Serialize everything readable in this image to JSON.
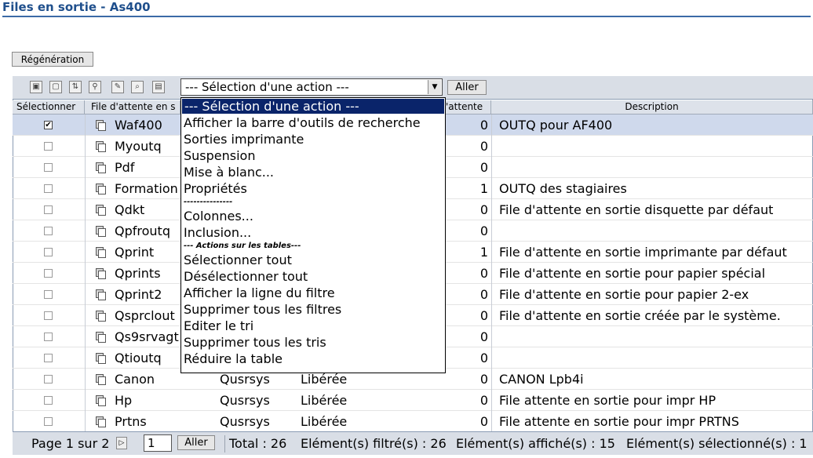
{
  "page": {
    "title": "Files en sortie - As400"
  },
  "regen_button": "Régénération",
  "toolbar": {
    "icons": [
      "select-all-icon",
      "deselect-all-icon",
      "filter-icon",
      "search-toolbar-icon",
      "edit-icon",
      "sort-icon",
      "columns-icon"
    ],
    "action_select_value": "--- Sélection d'une action ---",
    "go_label": "Aller"
  },
  "columns": {
    "select": "Sélectionner",
    "queue": "File d'attente en s",
    "queue_tail": "'attente",
    "description": "Description"
  },
  "rows": [
    {
      "name": "Waf400",
      "library": "",
      "state": "",
      "count": "0",
      "description": "OUTQ pour AF400",
      "selected": true
    },
    {
      "name": "Myoutq",
      "library": "",
      "state": "",
      "count": "0",
      "description": "",
      "selected": false
    },
    {
      "name": "Pdf",
      "library": "",
      "state": "",
      "count": "0",
      "description": "",
      "selected": false
    },
    {
      "name": "Formation",
      "library": "",
      "state": "",
      "count": "1",
      "description": "OUTQ des stagiaires",
      "selected": false
    },
    {
      "name": "Qdkt",
      "library": "",
      "state": "",
      "count": "0",
      "description": "File d'attente en sortie disquette par défaut",
      "selected": false
    },
    {
      "name": "Qpfroutq",
      "library": "",
      "state": "",
      "count": "0",
      "description": "",
      "selected": false
    },
    {
      "name": "Qprint",
      "library": "",
      "state": "",
      "count": "1",
      "description": "File d'attente en sortie imprimante par défaut",
      "selected": false
    },
    {
      "name": "Qprints",
      "library": "",
      "state": "",
      "count": "0",
      "description": "File d'attente en sortie pour papier spécial",
      "selected": false
    },
    {
      "name": "Qprint2",
      "library": "",
      "state": "",
      "count": "0",
      "description": "File d'attente en sortie pour papier 2-ex",
      "selected": false
    },
    {
      "name": "Qsprclout",
      "library": "",
      "state": "",
      "count": "0",
      "description": "File d'attente en sortie créée par le système.",
      "selected": false
    },
    {
      "name": "Qs9srvagt",
      "library": "",
      "state": "",
      "count": "0",
      "description": "",
      "selected": false
    },
    {
      "name": "Qtioutq",
      "library": "",
      "state": "",
      "count": "0",
      "description": "",
      "selected": false
    },
    {
      "name": "Canon",
      "library": "Qusrsys",
      "state": "Libérée",
      "count": "0",
      "description": "CANON Lpb4i",
      "selected": false
    },
    {
      "name": "Hp",
      "library": "Qusrsys",
      "state": "Libérée",
      "count": "0",
      "description": "File attente en sortie pour impr HP",
      "selected": false
    },
    {
      "name": "Prtns",
      "library": "Qusrsys",
      "state": "Libérée",
      "count": "0",
      "description": "File attente en sortie pour impr PRTNS",
      "selected": false
    }
  ],
  "dropdown": {
    "items": [
      {
        "label": "--- Sélection d'une action ---",
        "type": "highlight"
      },
      {
        "label": "Afficher la barre d'outils de recherche",
        "type": "item"
      },
      {
        "label": "Sorties imprimante",
        "type": "item"
      },
      {
        "label": "Suspension",
        "type": "item"
      },
      {
        "label": "Mise à blanc...",
        "type": "item"
      },
      {
        "label": "Propriétés",
        "type": "item"
      },
      {
        "label": "---------------",
        "type": "small"
      },
      {
        "label": "Colonnes...",
        "type": "item"
      },
      {
        "label": "Inclusion...",
        "type": "item"
      },
      {
        "label": "--- Actions sur les tables---",
        "type": "small"
      },
      {
        "label": "Sélectionner tout",
        "type": "item"
      },
      {
        "label": "Désélectionner tout",
        "type": "item"
      },
      {
        "label": "Afficher la ligne du filtre",
        "type": "item"
      },
      {
        "label": "Supprimer tous les filtres",
        "type": "item"
      },
      {
        "label": "Editer le tri",
        "type": "item"
      },
      {
        "label": "Supprimer tous les tris",
        "type": "item"
      },
      {
        "label": "Réduire la table",
        "type": "item"
      }
    ]
  },
  "footer": {
    "page_label": "Page 1 sur 2",
    "page_input": "1",
    "go_label": "Aller",
    "total": "Total : 26",
    "filtered": "Elément(s) filtré(s) : 26",
    "displayed": "Elément(s) affiché(s) : 15",
    "selected": "Elément(s) sélectionné(s) : 1"
  }
}
